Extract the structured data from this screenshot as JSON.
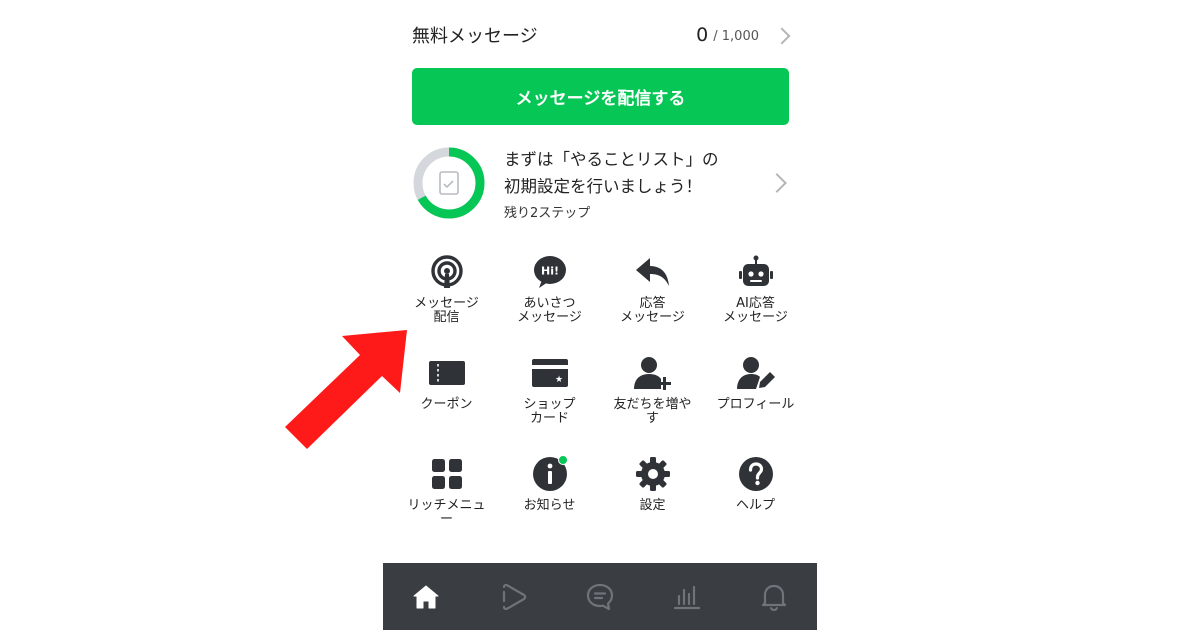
{
  "quota": {
    "label": "無料メッセージ",
    "used": "0",
    "limit": "/ 1,000"
  },
  "send_button": {
    "label": "メッセージを配信する"
  },
  "todo": {
    "title_line1": "まずは「やることリスト」の",
    "title_line2": "初期設定を行いましょう！",
    "sub": "残り2ステップ",
    "progress": 0.67
  },
  "grid": {
    "items": [
      {
        "label": "メッセージ\n配信",
        "icon": "broadcast-icon"
      },
      {
        "label": "あいさつ\nメッセージ",
        "icon": "hi-bubble-icon"
      },
      {
        "label": "応答\nメッセージ",
        "icon": "reply-arrow-icon"
      },
      {
        "label": "AI応答\nメッセージ",
        "icon": "robot-icon"
      },
      {
        "label": "クーポン",
        "icon": "coupon-icon"
      },
      {
        "label": "ショップ\nカード",
        "icon": "shop-card-icon"
      },
      {
        "label": "友だちを増や\nす",
        "icon": "add-friend-icon"
      },
      {
        "label": "プロフィール",
        "icon": "profile-edit-icon"
      },
      {
        "label": "リッチメニュ\nー",
        "icon": "rich-menu-icon"
      },
      {
        "label": "お知らせ",
        "icon": "info-icon"
      },
      {
        "label": "設定",
        "icon": "gear-icon"
      },
      {
        "label": "ヘルプ",
        "icon": "help-icon"
      }
    ]
  },
  "bottom_nav": {
    "items": [
      {
        "icon": "home-icon",
        "active": true
      },
      {
        "icon": "play-icon",
        "active": false
      },
      {
        "icon": "chat-icon",
        "active": false
      },
      {
        "icon": "chart-icon",
        "active": false
      },
      {
        "icon": "bell-icon",
        "active": false
      }
    ]
  },
  "colors": {
    "brand_green": "#06c755",
    "icon_dark": "#2f3337",
    "nav_bg": "#3a3d42",
    "arrow_red": "#ff1a1a"
  }
}
